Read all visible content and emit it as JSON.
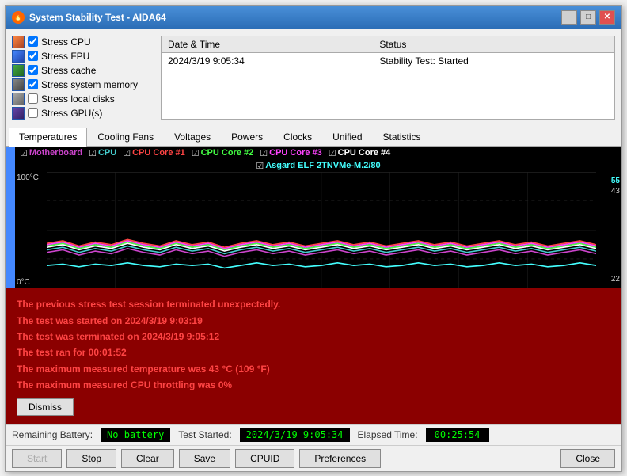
{
  "window": {
    "title": "System Stability Test - AIDA64",
    "icon": "🔥"
  },
  "titleControls": {
    "minimize": "—",
    "maximize": "□",
    "close": "✕"
  },
  "checkboxes": [
    {
      "id": "stress-cpu",
      "label": "Stress CPU",
      "checked": true,
      "iconClass": "icon-cpu"
    },
    {
      "id": "stress-fpu",
      "label": "Stress FPU",
      "checked": true,
      "iconClass": "icon-fpu"
    },
    {
      "id": "stress-cache",
      "label": "Stress cache",
      "checked": true,
      "iconClass": "icon-cache"
    },
    {
      "id": "stress-mem",
      "label": "Stress system memory",
      "checked": true,
      "iconClass": "icon-mem"
    },
    {
      "id": "stress-disk",
      "label": "Stress local disks",
      "checked": false,
      "iconClass": "icon-disk"
    },
    {
      "id": "stress-gpu",
      "label": "Stress GPU(s)",
      "checked": false,
      "iconClass": "icon-gpu"
    }
  ],
  "statusTable": {
    "headers": [
      "Date & Time",
      "Status"
    ],
    "rows": [
      {
        "datetime": "2024/3/19 9:05:34",
        "status": "Stability Test: Started"
      }
    ]
  },
  "tabs": [
    {
      "label": "Temperatures",
      "active": true
    },
    {
      "label": "Cooling Fans",
      "active": false
    },
    {
      "label": "Voltages",
      "active": false
    },
    {
      "label": "Powers",
      "active": false
    },
    {
      "label": "Clocks",
      "active": false
    },
    {
      "label": "Unified",
      "active": false
    },
    {
      "label": "Statistics",
      "active": false
    }
  ],
  "legend": {
    "row1": [
      {
        "label": "Motherboard",
        "color": "#aa44aa",
        "checked": true
      },
      {
        "label": "CPU",
        "color": "#44aaaa",
        "checked": true
      },
      {
        "label": "CPU Core #1",
        "color": "#ff4444",
        "checked": true
      },
      {
        "label": "CPU Core #2",
        "color": "#44ff44",
        "checked": true
      },
      {
        "label": "CPU Core #3",
        "color": "#ff44ff",
        "checked": true
      },
      {
        "label": "CPU Core #4",
        "color": "#ffffff",
        "checked": true
      }
    ],
    "row2": [
      {
        "label": "Asgard ELF 2TNVMe-M.2/80",
        "color": "#44ffff",
        "checked": true
      }
    ]
  },
  "graphYAxis": {
    "top": "100°C",
    "bottom": "0°C",
    "rightTop": "43",
    "rightTopHighlight": "55",
    "rightBottom": "22"
  },
  "errorPanel": {
    "lines": [
      "The previous stress test session terminated unexpectedly.",
      "The test was started on 2024/3/19 9:03:19",
      "The test was terminated on 2024/3/19 9:05:12",
      "The test ran for 00:01:52",
      "The maximum measured temperature was 43 °C (109 °F)",
      "The maximum measured CPU throttling was 0%"
    ],
    "dismissLabel": "Dismiss"
  },
  "statusBar": {
    "batteryLabel": "Remaining Battery:",
    "batteryValue": "No battery",
    "testStartedLabel": "Test Started:",
    "testStartedValue": "2024/3/19 9:05:34",
    "elapsedLabel": "Elapsed Time:",
    "elapsedValue": "00:25:54"
  },
  "buttons": {
    "start": "Start",
    "stop": "Stop",
    "clear": "Clear",
    "save": "Save",
    "cpuid": "CPUID",
    "preferences": "Preferences",
    "close": "Close"
  }
}
